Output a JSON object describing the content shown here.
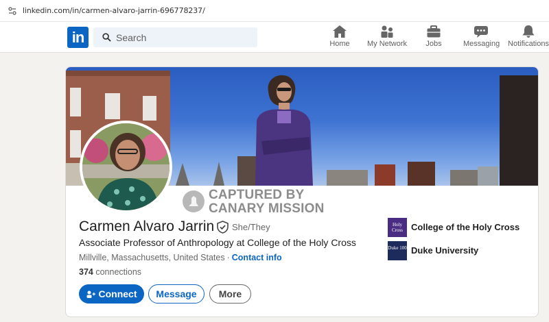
{
  "browser": {
    "url": "linkedin.com/in/carmen-alvaro-jarrin-696778237/"
  },
  "nav": {
    "search_placeholder": "Search",
    "items": [
      {
        "label": "Home",
        "icon": "home-icon"
      },
      {
        "label": "My Network",
        "icon": "network-icon"
      },
      {
        "label": "Jobs",
        "icon": "briefcase-icon"
      },
      {
        "label": "Messaging",
        "icon": "messaging-icon"
      },
      {
        "label": "Notifications",
        "icon": "bell-icon"
      }
    ]
  },
  "watermark": {
    "line1": "CAPTURED BY",
    "line2": "CANARY MISSION"
  },
  "profile": {
    "name": "Carmen Alvaro Jarrin",
    "pronouns": "She/They",
    "headline": "Associate Professor of Anthropology at College of the Holy Cross",
    "location": "Millville, Massachusetts, United States",
    "location_sep": "·",
    "contact_info": "Contact info",
    "connections_count": "374",
    "connections_label": "connections"
  },
  "actions": {
    "connect": "Connect",
    "message": "Message",
    "more": "More"
  },
  "education": [
    {
      "name": "College of the Holy Cross",
      "logo_text": "Holy Cross",
      "logo_color": "#4b2c83"
    },
    {
      "name": "Duke University",
      "logo_text": "Duke 100",
      "logo_color": "#1d2a5c"
    }
  ],
  "colors": {
    "brand": "#0a66c2",
    "background": "#f4f2ee"
  }
}
